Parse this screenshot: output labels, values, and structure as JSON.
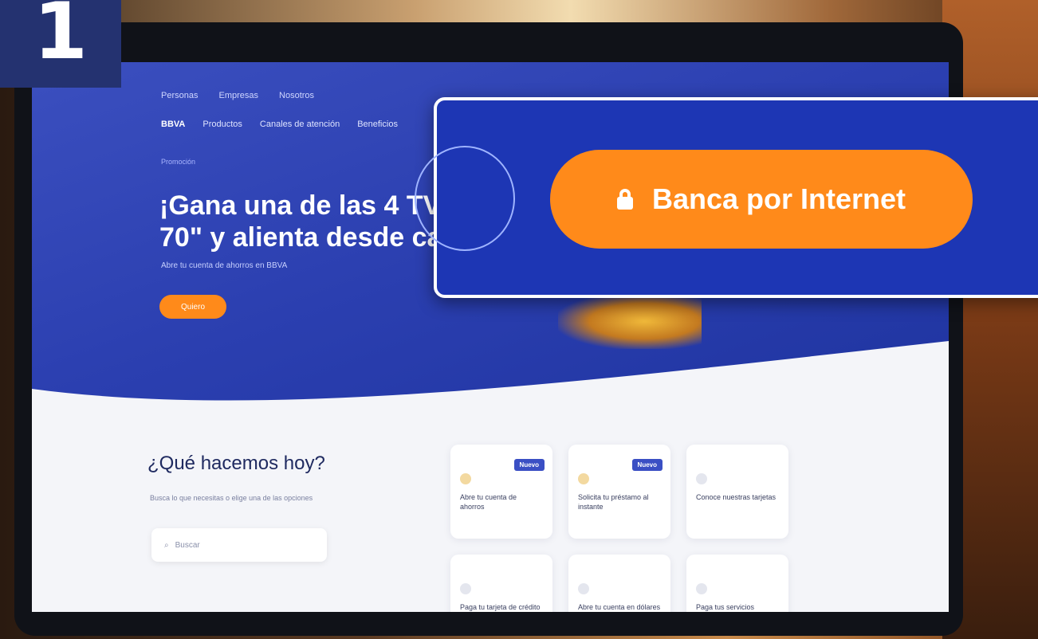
{
  "step_number": "1",
  "site": {
    "utility_nav": [
      "Personas",
      "Empresas",
      "Nosotros"
    ],
    "main_nav": {
      "logo": "BBVA",
      "items": [
        "Productos",
        "Canales de atención",
        "Beneficios"
      ]
    },
    "hero": {
      "eyebrow": "Promoción",
      "title": "¡Gana una de las 4 TVs de\n70\" y alienta desde casa!",
      "subtitle": "Abre tu cuenta de ahorros en BBVA",
      "cta": "Quiero"
    },
    "what_section": {
      "title": "¿Qué hacemos hoy?",
      "description": "Busca lo que necesitas o elige una de las opciones",
      "search_placeholder": "Buscar"
    },
    "cards": [
      {
        "label": "Abre tu cuenta de ahorros",
        "badge": "Nuevo"
      },
      {
        "label": "Solicita tu préstamo al instante",
        "badge": "Nuevo"
      },
      {
        "label": "Conoce nuestras tarjetas",
        "badge": ""
      },
      {
        "label": "Paga tu tarjeta de crédito",
        "badge": ""
      },
      {
        "label": "Abre tu cuenta en dólares",
        "badge": ""
      },
      {
        "label": "Paga tus servicios",
        "badge": ""
      }
    ]
  },
  "overlay": {
    "button_label": "Banca por Internet"
  },
  "colors": {
    "brand_blue": "#1d36b4",
    "accent_orange": "#ff8a1a",
    "step_bg": "#243270"
  }
}
